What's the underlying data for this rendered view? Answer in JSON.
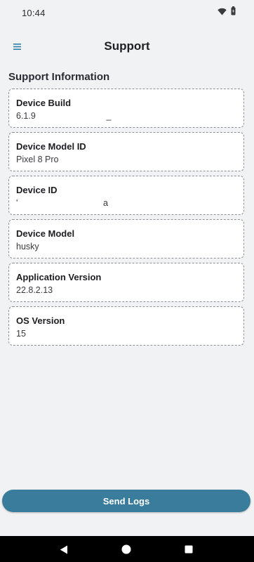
{
  "status_bar": {
    "time": "10:44",
    "icons": [
      "wifi-icon",
      "battery-icon"
    ]
  },
  "app_bar": {
    "title": "Support",
    "menu_icon": "hamburger-menu-icon",
    "accent_color": "#2f7fa6"
  },
  "section": {
    "title": "Support Information"
  },
  "cards": [
    {
      "label": "Device Build",
      "value": "6.1.9                             _"
    },
    {
      "label": "Device Model ID",
      "value": "Pixel 8 Pro"
    },
    {
      "label": "Device ID",
      "value": "'                                   a"
    },
    {
      "label": "Device Model",
      "value": "husky"
    },
    {
      "label": "Application Version",
      "value": "22.8.2.13"
    },
    {
      "label": "OS Version",
      "value": "15"
    }
  ],
  "send_logs_button": {
    "label": "Send Logs",
    "color": "#397c9b"
  },
  "nav_bar": {
    "buttons": [
      "back-icon",
      "home-icon",
      "recents-icon"
    ]
  }
}
